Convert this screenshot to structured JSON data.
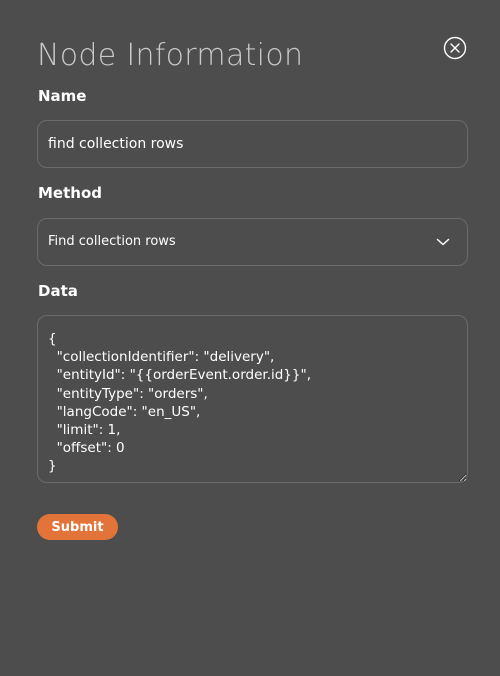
{
  "header": {
    "title": "Node Information",
    "close_icon": "circle-x-icon"
  },
  "form": {
    "name": {
      "label": "Name",
      "value": "find collection rows"
    },
    "method": {
      "label": "Method",
      "selected": "Find collection rows",
      "icon": "chevron-down-icon"
    },
    "data": {
      "label": "Data",
      "value": "{\n  \"collectionIdentifier\": \"delivery\",\n  \"entityId\": \"{{orderEvent.order.id}}\",\n  \"entityType\": \"orders\",\n  \"langCode\": \"en_US\",\n  \"limit\": 1,\n  \"offset\": 0\n}"
    },
    "submit_label": "Submit"
  },
  "colors": {
    "background": "#4e4d4d",
    "title": "#c9c9c9",
    "border": "#6b6a6a",
    "accent": "#e2743a",
    "text": "#ffffff"
  }
}
